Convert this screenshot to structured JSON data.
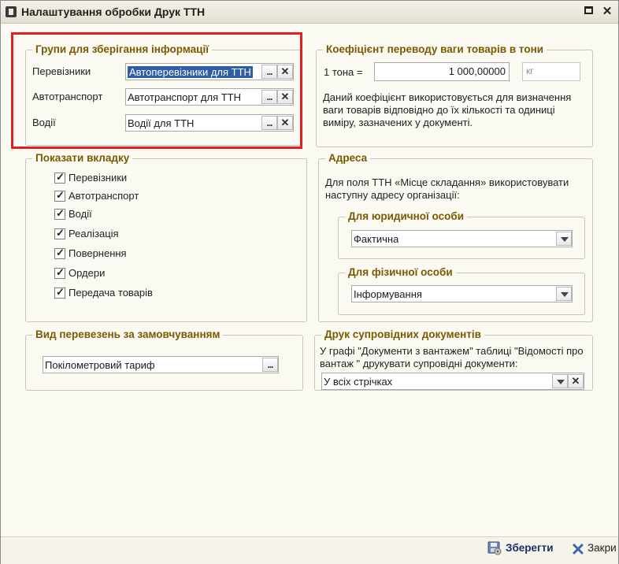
{
  "window": {
    "title": "Налаштування обробки Друк ТТН"
  },
  "groups_storage": {
    "legend": "Групи для зберігання інформації",
    "rows": [
      {
        "label": "Перевізники",
        "value": "Автоперевізники для ТТН"
      },
      {
        "label": "Автотранспорт",
        "value": "Автотранспорт для ТТН"
      },
      {
        "label": "Водії",
        "value": "Водії для ТТН"
      }
    ]
  },
  "weight_coef": {
    "legend": "Коефіцієнт переводу ваги товарів в тони",
    "label": "1 тона =",
    "value": "1 000,00000",
    "unit": "кг",
    "description": "Даний коефіцієнт використовується для визначення ваги товарів відповідно до їх кількості та одиниці виміру, зазначених у документі."
  },
  "show_tabs": {
    "legend": "Показати вкладку",
    "items": [
      {
        "label": "Перевізники",
        "checked": true
      },
      {
        "label": "Автотранспорт",
        "checked": true
      },
      {
        "label": "Водії",
        "checked": true
      },
      {
        "label": "Реалізація",
        "checked": true
      },
      {
        "label": "Повернення",
        "checked": true
      },
      {
        "label": "Ордери",
        "checked": true
      },
      {
        "label": "Передача товарів",
        "checked": true
      }
    ]
  },
  "address": {
    "legend": "Адреса",
    "description": "Для поля ТТН «Місце складання» використовувати наступну адресу організації:",
    "legal": {
      "legend": "Для юридичної особи",
      "value": "Фактична"
    },
    "individual": {
      "legend": "Для фізичної особи",
      "value": "Інформування"
    }
  },
  "transport_type": {
    "legend": "Вид перевезень за замовчуванням",
    "value": "Покілометровий тариф"
  },
  "print_docs": {
    "legend": "Друк супровідних документів",
    "description": "У графі \"Документи з вантажем\" таблиці \"Відомості про вантаж \" друкувати супровідні документи:",
    "value": "У всіх стрічках"
  },
  "actions": {
    "save": "Зберегти",
    "close": "Закри"
  }
}
